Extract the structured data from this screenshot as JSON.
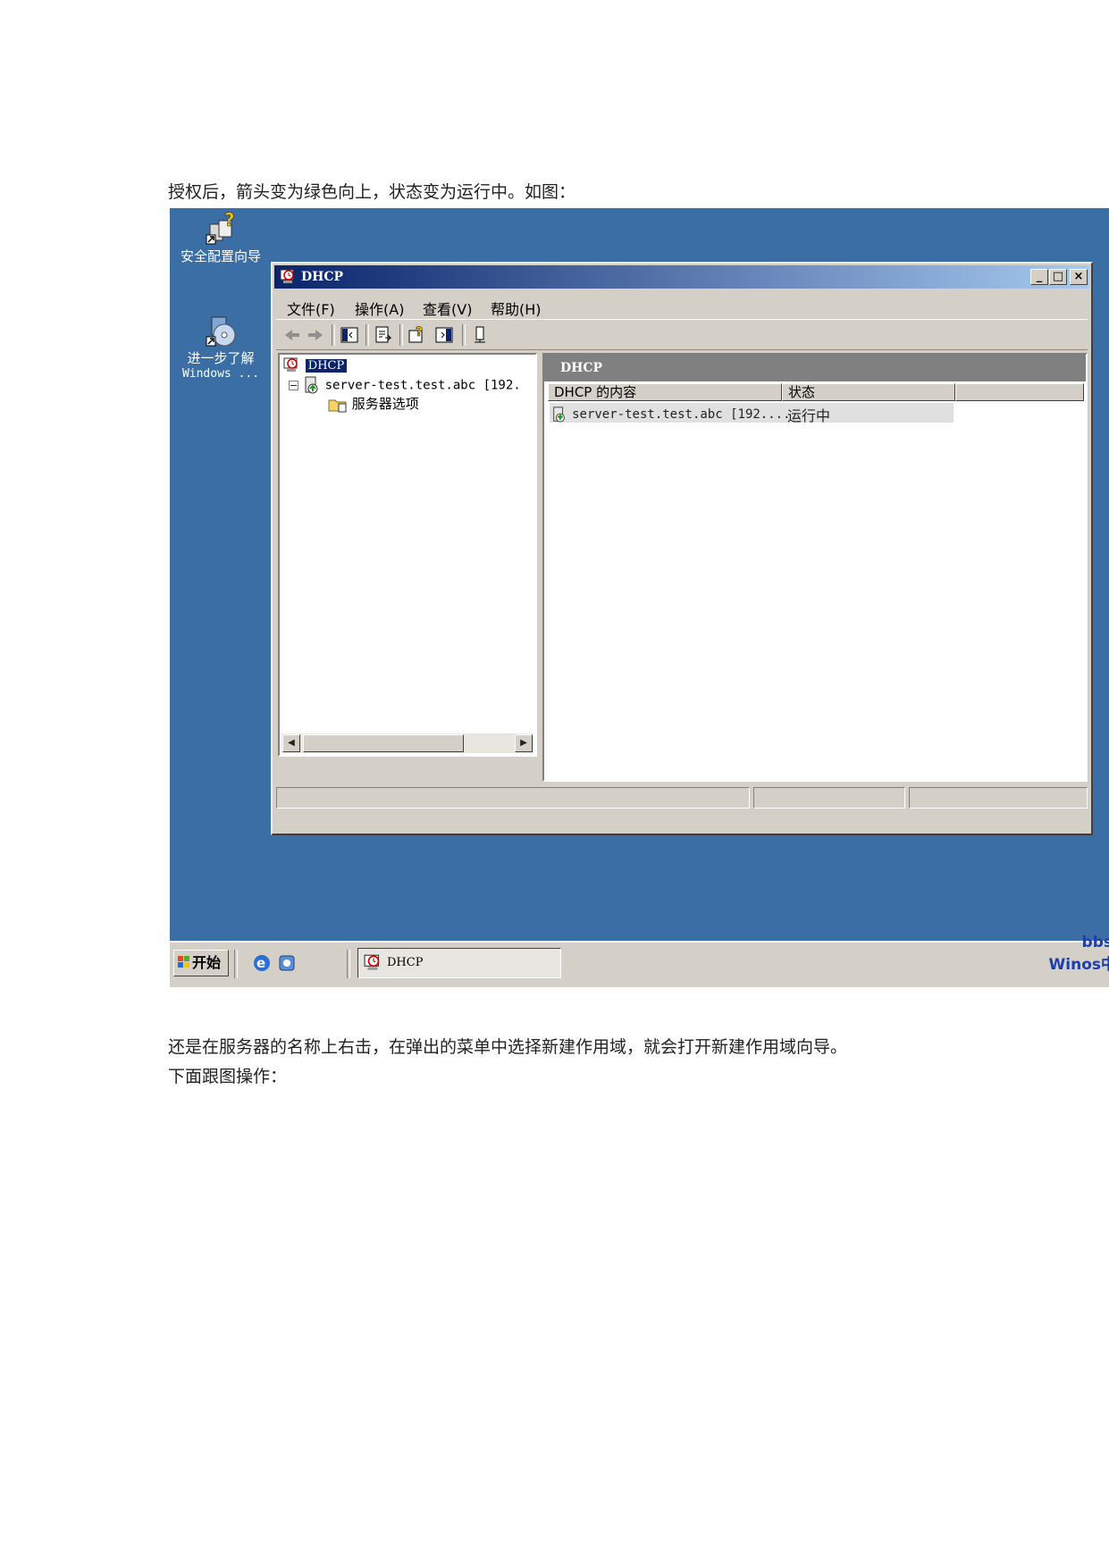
{
  "document": {
    "para1": "授权后，箭头变为绿色向上，状态变为运行中。如图：",
    "para2": "还是在服务器的名称上右击，在弹出的菜单中选择新建作用域，就会打开新建作用域向导。",
    "para3": "下面跟图操作："
  },
  "desktop": {
    "icons": [
      {
        "label": "安全配置向导"
      },
      {
        "label": "进一步了解",
        "sublabel": "Windows ..."
      }
    ]
  },
  "window": {
    "title": "DHCP",
    "caption_buttons": [
      "_",
      "□",
      "×"
    ],
    "menus": [
      "文件(F)",
      "操作(A)",
      "查看(V)",
      "帮助(H)"
    ],
    "toolbar_icons": [
      "back-arrow-icon",
      "forward-arrow-icon",
      "show-hide-tree-icon",
      "export-list-icon",
      "help-icon",
      "action-pane-icon",
      "server-status-icon"
    ]
  },
  "tree": {
    "root": "DHCP",
    "server": "server-test.test.abc [192.",
    "options": "服务器选项"
  },
  "list": {
    "band_title": "DHCP",
    "columns": [
      "DHCP 的内容",
      "状态"
    ],
    "rows": [
      {
        "name": "server-test.test.abc [192....",
        "status": "运行中"
      }
    ]
  },
  "taskbar": {
    "start_label": "开始",
    "task_title": "DHCP",
    "watermark1": "bbs",
    "watermark2": "Winos中"
  },
  "colors": {
    "desktop": "#3a6ea5",
    "title_gradient_start": "#0a246a",
    "title_gradient_end": "#a6caf0",
    "chrome": "#d4d0c8",
    "watermark": "#1f3fa8"
  }
}
